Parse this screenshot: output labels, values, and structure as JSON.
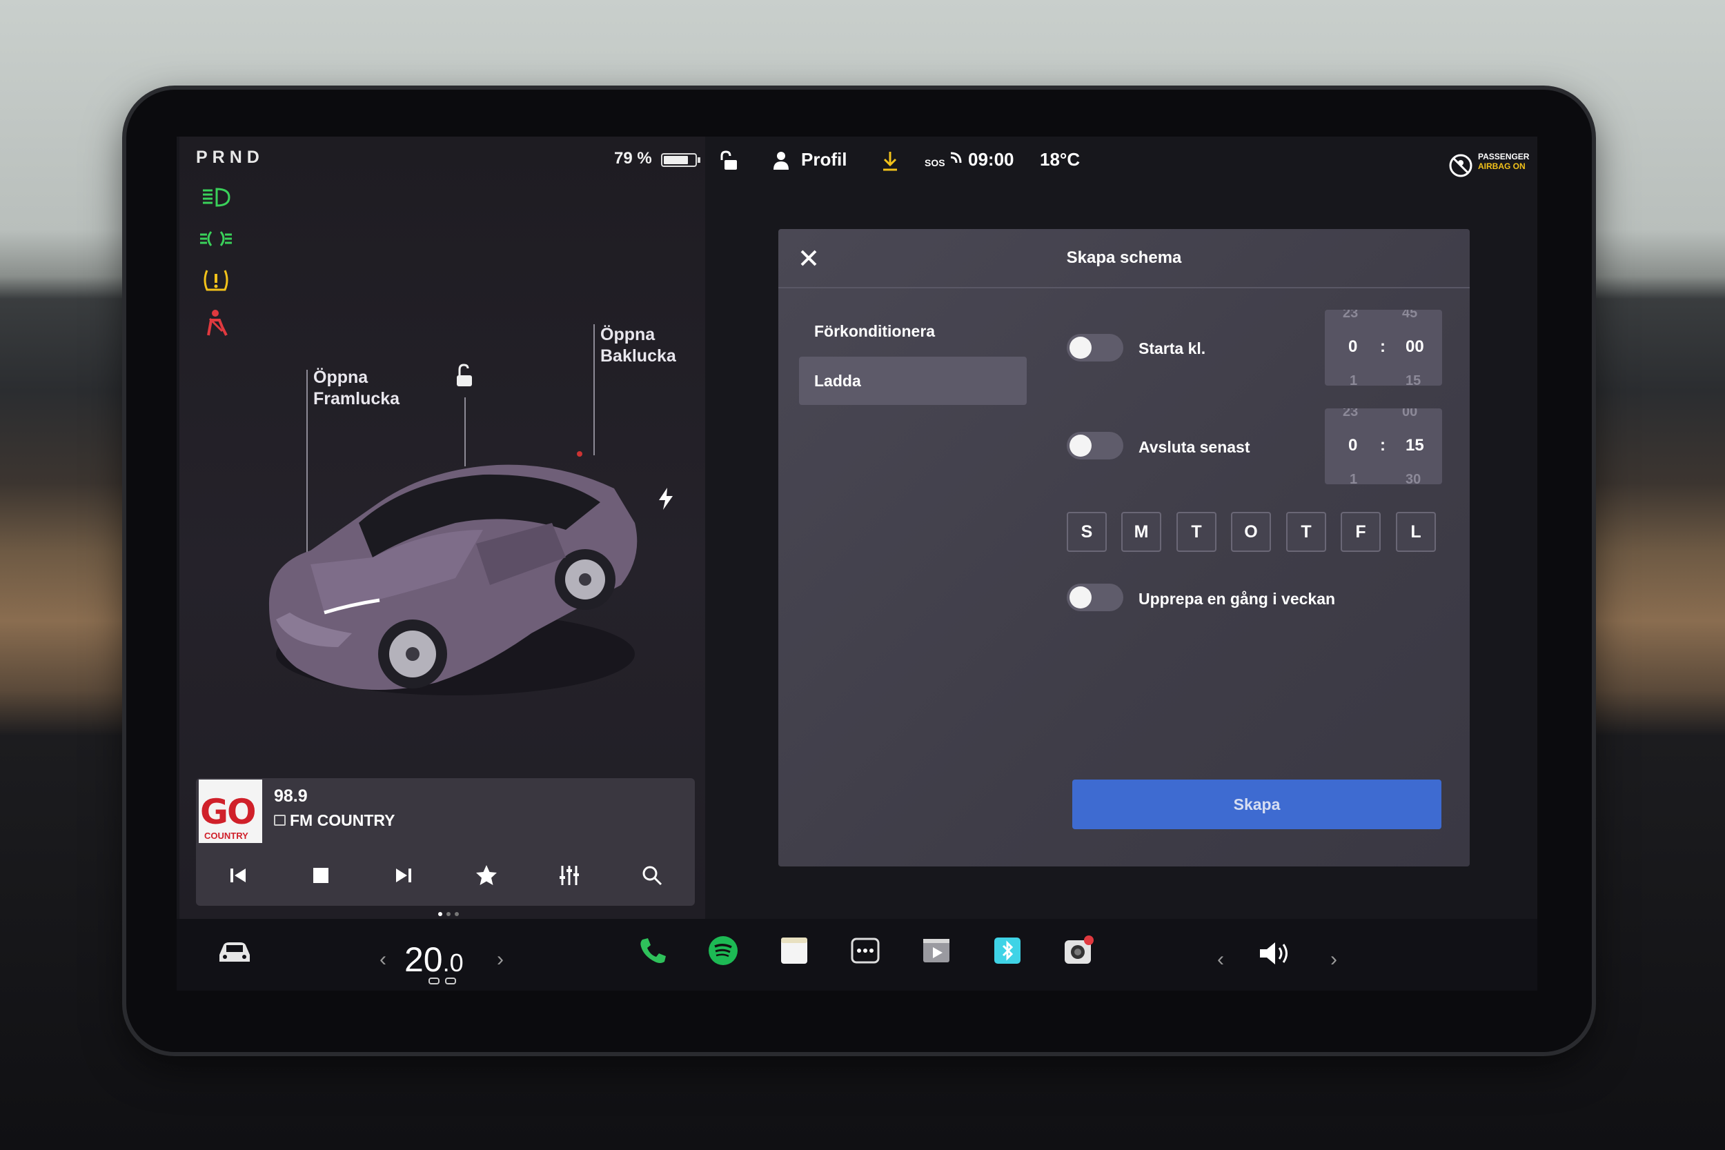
{
  "status_bar": {
    "gear": "PRND",
    "battery": "79 %",
    "battery_level": 0.79,
    "profile": "Profil",
    "sos": "SOS",
    "time": "09:00",
    "outside_temp": "18°C",
    "airbag_line1": "PASSENGER",
    "airbag_line2": "AIRBAG ON"
  },
  "car_panel": {
    "frunk_line1": "Öppna",
    "frunk_line2": "Framlucka",
    "trunk_line1": "Öppna",
    "trunk_line2": "Baklucka"
  },
  "media": {
    "logo_text": "GO",
    "logo_sub": "COUNTRY",
    "frequency": "98.9",
    "station": "FM COUNTRY",
    "controls": [
      "previous-icon",
      "stop-icon",
      "next-icon",
      "favorite-icon",
      "equalizer-icon",
      "search-icon"
    ]
  },
  "dialog": {
    "title": "Skapa schema",
    "sidebar": [
      {
        "label": "Förkonditionera",
        "active": false
      },
      {
        "label": "Ladda",
        "active": true
      }
    ],
    "start": {
      "label": "Starta kl.",
      "enabled": false,
      "prev_hour": "23",
      "prev_min": "45",
      "hour": "0",
      "sep": ":",
      "minute": "00",
      "next_hour": "1",
      "next_min": "15"
    },
    "end": {
      "label": "Avsluta senast",
      "enabled": false,
      "prev_hour": "23",
      "prev_min": "00",
      "hour": "0",
      "sep": ":",
      "minute": "15",
      "next_hour": "1",
      "next_min": "30"
    },
    "days": [
      "S",
      "M",
      "T",
      "O",
      "T",
      "F",
      "L"
    ],
    "repeat": {
      "label": "Upprepa en gång i veckan",
      "enabled": false
    },
    "create_button": "Skapa"
  },
  "bottom_bar": {
    "temp_int": "20",
    "temp_dec": ".0",
    "apps": [
      "phone-icon",
      "spotify-icon",
      "notes-icon",
      "more-apps-icon",
      "media-player-icon",
      "bluetooth-icon",
      "camera-icon"
    ]
  },
  "colors": {
    "accent_blue": "#3e6bd1",
    "telltale_green": "#3ad15a",
    "telltale_yellow": "#f2c21a",
    "telltale_red": "#e0393f",
    "phone_green": "#2fc15b",
    "spotify_green": "#1db954"
  }
}
